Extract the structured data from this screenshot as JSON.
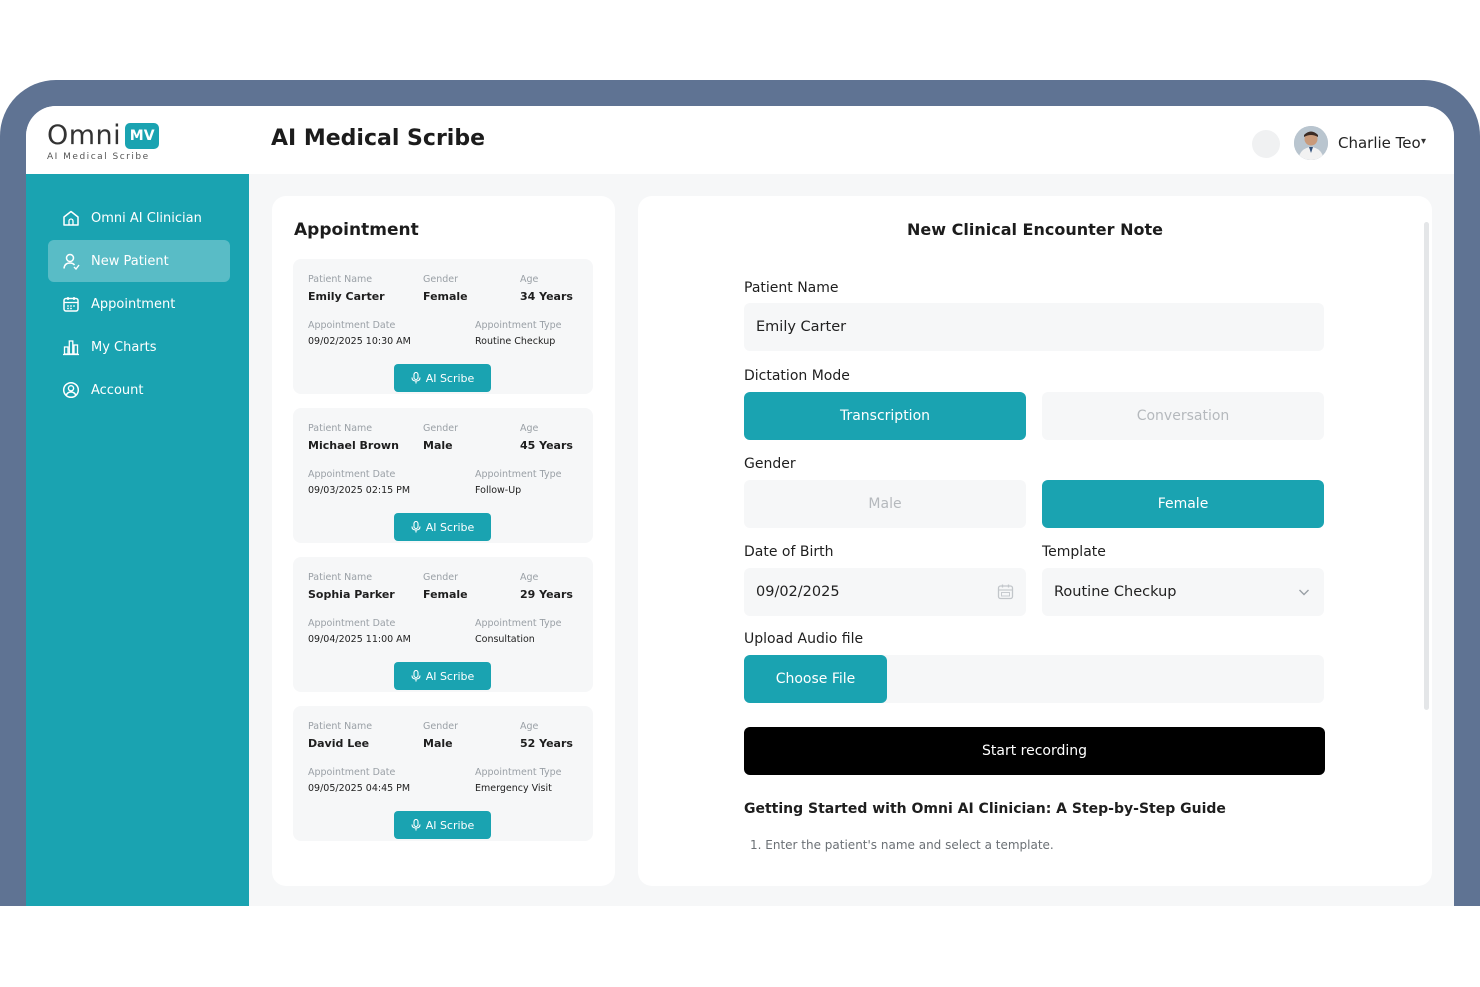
{
  "app": {
    "logo_text": "Omni",
    "logo_badge": "MV",
    "logo_sub": "AI Medical Scribe",
    "page_title": "AI Medical Scribe"
  },
  "user": {
    "name": "Charlie Teo",
    "caret": "▾"
  },
  "sidebar": {
    "items": [
      {
        "label": "Omni AI Clinician",
        "icon": "home-icon",
        "active": false
      },
      {
        "label": "New Patient",
        "icon": "user-icon",
        "active": true
      },
      {
        "label": "Appointment",
        "icon": "calendar-icon",
        "active": false
      },
      {
        "label": "My Charts",
        "icon": "bar-chart-icon",
        "active": false
      },
      {
        "label": "Account",
        "icon": "account-circle-icon",
        "active": false
      }
    ]
  },
  "appointments": {
    "title": "Appointment",
    "labels": {
      "patient_name": "Patient Name",
      "gender": "Gender",
      "age": "Age",
      "date": "Appointment Date",
      "type": "Appointment Type",
      "button": "AI Scribe"
    },
    "cards": [
      {
        "name": "Emily Carter",
        "gender": "Female",
        "age": "34 Years",
        "date": "09/02/2025 10:30 AM",
        "type": "Routine Checkup"
      },
      {
        "name": "Michael Brown",
        "gender": "Male",
        "age": "45 Years",
        "date": "09/03/2025 02:15 PM",
        "type": "Follow-Up"
      },
      {
        "name": "Sophia Parker",
        "gender": "Female",
        "age": "29 Years",
        "date": "09/04/2025 11:00 AM",
        "type": "Consultation"
      },
      {
        "name": "David Lee",
        "gender": "Male",
        "age": "52 Years",
        "date": "09/05/2025 04:45 PM",
        "type": "Emergency Visit"
      }
    ]
  },
  "note": {
    "title": "New Clinical Encounter Note",
    "patient_name_label": "Patient Name",
    "patient_name_value": "Emily Carter",
    "dictation_label": "Dictation Mode",
    "dictation_options": [
      "Transcription",
      "Conversation"
    ],
    "dictation_selected": "Transcription",
    "gender_label": "Gender",
    "gender_options": [
      "Male",
      "Female"
    ],
    "gender_selected": "Female",
    "dob_label": "Date of Birth",
    "dob_value": "09/02/2025",
    "template_label": "Template",
    "template_value": "Routine Checkup",
    "upload_label": "Upload Audio file",
    "choose_file": "Choose File",
    "start_recording": "Start recording",
    "guide_title": "Getting Started with Omni AI Clinician: A Step-by-Step Guide",
    "guide_step_1": "1.  Enter the patient's name and select a template."
  },
  "colors": {
    "accent": "#1aa3b1",
    "frame": "#5f7393",
    "background": "#f6f7f8"
  }
}
